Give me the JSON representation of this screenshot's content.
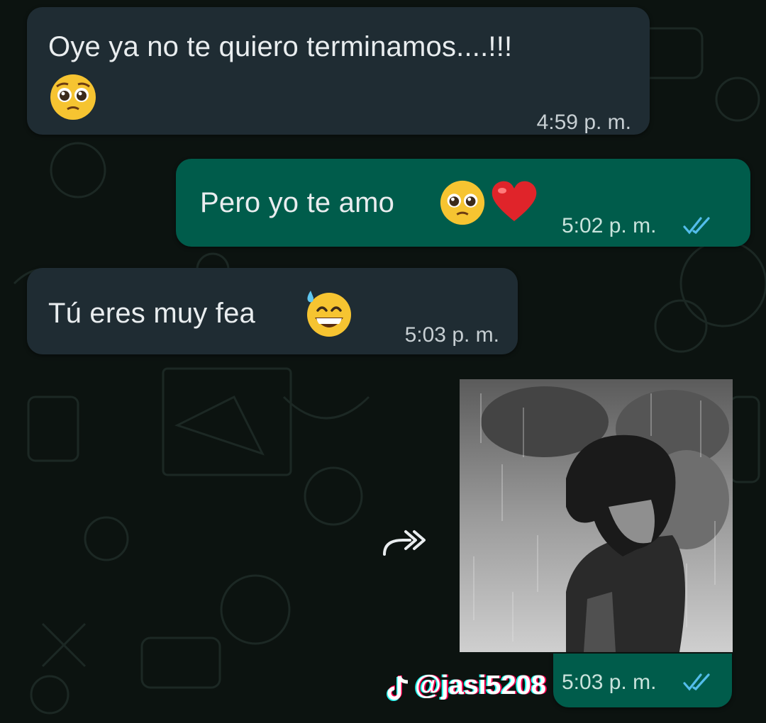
{
  "messages": [
    {
      "direction": "incoming",
      "text": "Oye ya no te quiero terminamos....!!!",
      "emoji": "pleading-face",
      "time": "4:59 p. m."
    },
    {
      "direction": "outgoing",
      "text": "Pero yo te amo",
      "emoji": "pleading-face red-heart",
      "time": "5:02 p. m.",
      "status": "read"
    },
    {
      "direction": "incoming",
      "text": "Tú eres muy fea",
      "emoji": "grinning-face-with-sweat",
      "time": "5:03 p. m."
    },
    {
      "direction": "outgoing",
      "type": "image",
      "image_description": "sad-anime-boy-in-rain",
      "time": "5:03 p. m.",
      "status": "read",
      "forward_icon": "forward-icon"
    }
  ],
  "watermark": {
    "platform_icon": "tiktok-logo",
    "handle": "@jasi5208"
  },
  "colors": {
    "incoming_bubble": "#1f2c33",
    "outgoing_bubble": "#005c4b",
    "background": "#0c1310",
    "read_ticks": "#53bdeb"
  }
}
